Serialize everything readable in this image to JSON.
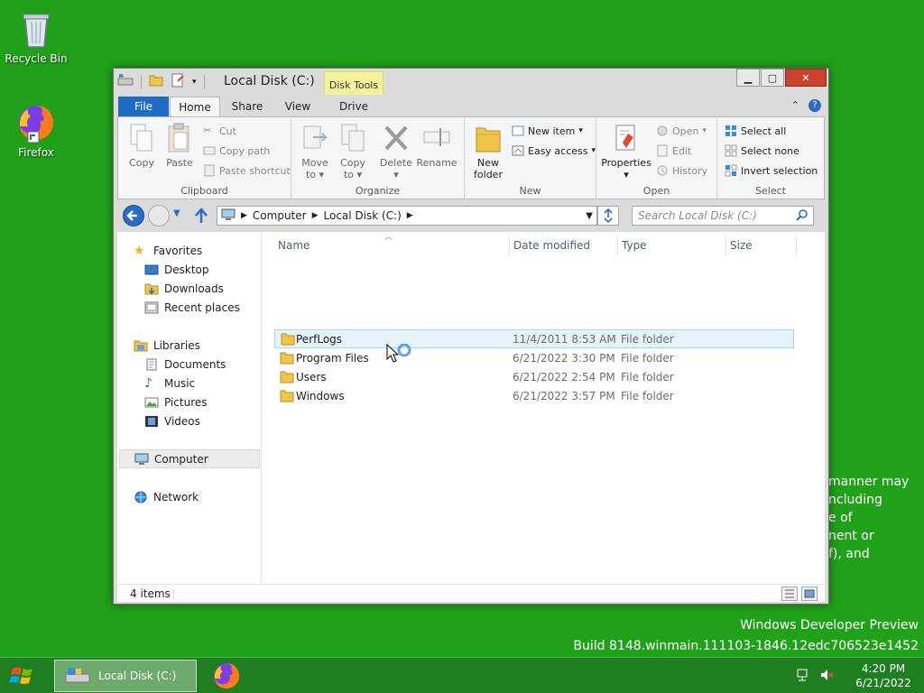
{
  "desktop": {
    "icons": [
      {
        "label": "Recycle Bin"
      },
      {
        "label": "Firefox"
      }
    ],
    "background_text": [
      "manner may",
      "ncluding",
      "e of",
      "nent or",
      "f), and"
    ],
    "watermark": {
      "line1": "Windows Developer Preview",
      "line2": "Build 8148.winmain.111103-1846.12edc706523e1452"
    }
  },
  "window": {
    "title": "Local Disk (C:)",
    "context_tab": "Disk Tools",
    "tabs": [
      "File",
      "Home",
      "Share",
      "View",
      "Drive"
    ],
    "active_tab": "Home",
    "ribbon": {
      "clipboard": {
        "label": "Clipboard",
        "copy": "Copy",
        "paste": "Paste",
        "cut": "Cut",
        "copy_path": "Copy path",
        "paste_shortcut": "Paste shortcut"
      },
      "organize": {
        "label": "Organize",
        "move_to": "Move",
        "move_to_2": "to",
        "copy_to": "Copy",
        "copy_to_2": "to",
        "delete": "Delete",
        "rename": "Rename"
      },
      "new": {
        "label": "New",
        "new_folder": "New",
        "new_folder_2": "folder",
        "new_item": "New item",
        "easy_access": "Easy access"
      },
      "open": {
        "label": "Open",
        "properties": "Properties",
        "open": "Open",
        "edit": "Edit",
        "history": "History"
      },
      "select": {
        "label": "Select",
        "select_all": "Select all",
        "select_none": "Select none",
        "invert_selection": "Invert selection"
      }
    },
    "address": {
      "segments": [
        "Computer",
        "Local Disk (C:)"
      ],
      "search_placeholder": "Search Local Disk (C:)"
    },
    "nav_pane": {
      "favorites": "Favorites",
      "desktop": "Desktop",
      "downloads": "Downloads",
      "recent_places": "Recent places",
      "libraries": "Libraries",
      "documents": "Documents",
      "music": "Music",
      "pictures": "Pictures",
      "videos": "Videos",
      "computer": "Computer",
      "network": "Network"
    },
    "columns": {
      "name": "Name",
      "date_modified": "Date modified",
      "type": "Type",
      "size": "Size"
    },
    "files": [
      {
        "name": "PerfLogs",
        "date": "11/4/2011 8:53 AM",
        "type": "File folder"
      },
      {
        "name": "Program Files",
        "date": "6/21/2022 3:30 PM",
        "type": "File folder"
      },
      {
        "name": "Users",
        "date": "6/21/2022 2:54 PM",
        "type": "File folder"
      },
      {
        "name": "Windows",
        "date": "6/21/2022 3:57 PM",
        "type": "File folder"
      }
    ],
    "status": "4 items"
  },
  "taskbar": {
    "item_label": "Local Disk (C:)",
    "time": "4:20 PM",
    "date": "6/21/2022"
  },
  "colors": {
    "desktop": "#21a11a",
    "file_tab": "#1e6cc4",
    "selection": "#e5f3fb",
    "close_button": "#c7432f"
  }
}
